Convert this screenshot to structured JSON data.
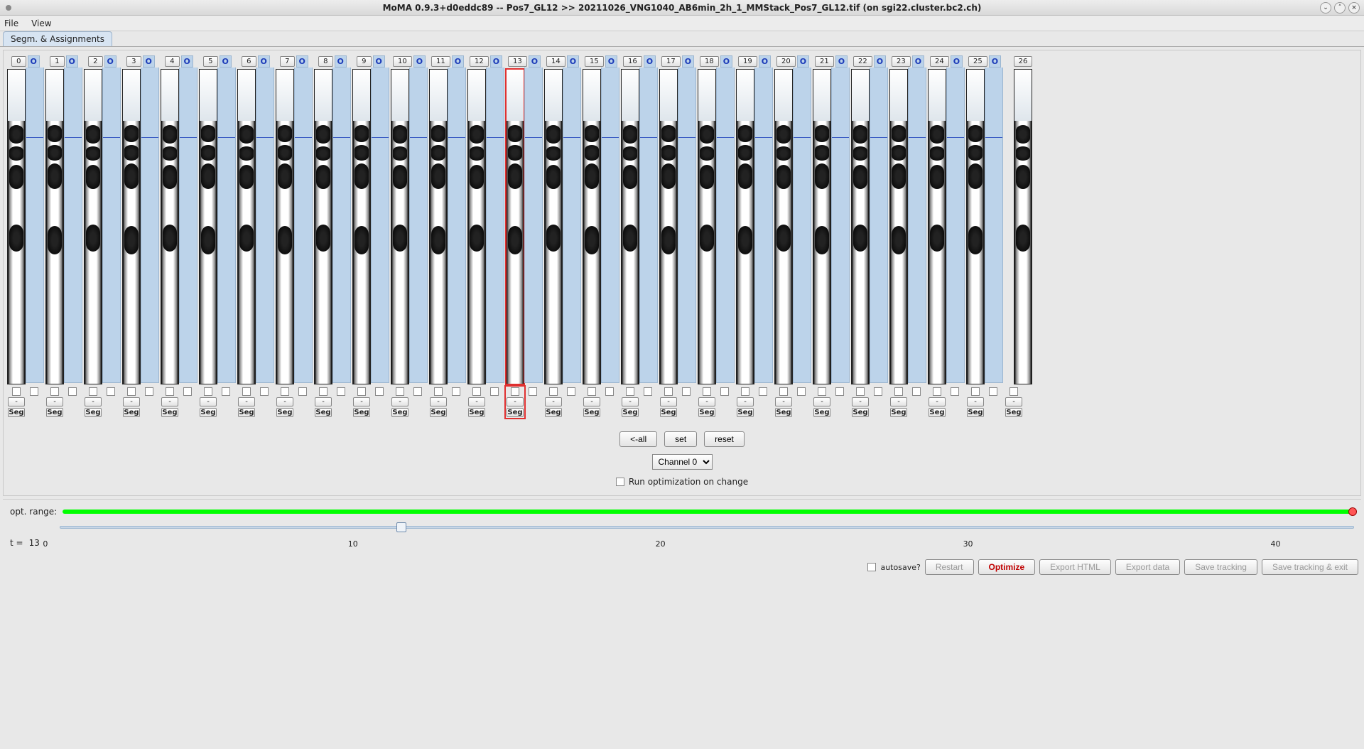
{
  "window_title": "MoMA 0.9.3+d0eddc89 -- Pos7_GL12 >> 20211026_VNG1040_AB6min_2h_1_MMStack_Pos7_GL12.tif (on sgi22.cluster.bc2.ch)",
  "menu": {
    "file": "File",
    "view": "View"
  },
  "tab_label": "Segm. & Assignments",
  "o_label": "O",
  "seg_label": "Seg",
  "dash_label": "-",
  "lane_count": 27,
  "highlight_index": 13,
  "buttons": {
    "all": "<-all",
    "set": "set",
    "reset": "reset"
  },
  "channel_select": "Channel 0",
  "run_opt": "Run optimization on change",
  "opt_range_label": "opt. range:",
  "t_label": "t =",
  "t_value": "13",
  "ticks": [
    "0",
    "10",
    "20",
    "30",
    "40"
  ],
  "slider_percent": 26,
  "autosave": "autosave?",
  "actions": {
    "restart": "Restart",
    "optimize": "Optimize",
    "export_html": "Export HTML",
    "export_data": "Export data",
    "save_tracking": "Save tracking",
    "save_exit": "Save tracking & exit"
  },
  "win": {
    "min": "⌄",
    "max": "˄",
    "close": "×"
  }
}
